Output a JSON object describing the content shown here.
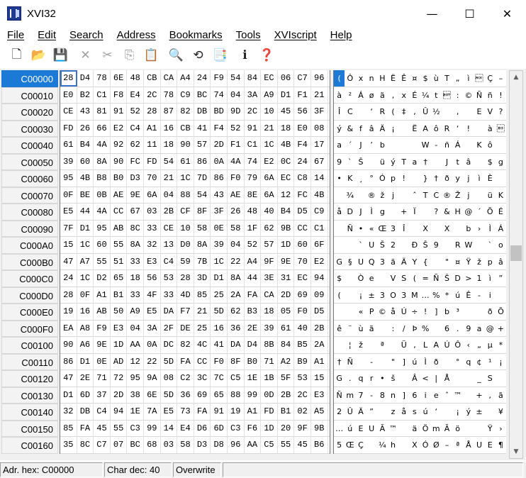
{
  "window": {
    "title": "XVI32",
    "minimize": "—",
    "maximize": "☐",
    "close": "✕"
  },
  "menu": [
    "File",
    "Edit",
    "Search",
    "Address",
    "Bookmarks",
    "Tools",
    "XVIscript",
    "Help"
  ],
  "toolbar": [
    {
      "name": "new-file-icon",
      "glyph": "🗋",
      "disabled": false
    },
    {
      "name": "open-folder-icon",
      "glyph": "📂",
      "disabled": false
    },
    {
      "name": "save-icon",
      "glyph": "💾",
      "disabled": false
    },
    {
      "name": "delete-icon",
      "glyph": "✕",
      "disabled": true
    },
    {
      "name": "cut-icon",
      "glyph": "✂",
      "disabled": true
    },
    {
      "name": "copy-icon",
      "glyph": "⎘",
      "disabled": true
    },
    {
      "name": "paste-icon",
      "glyph": "📋",
      "disabled": true
    },
    {
      "name": "find-icon",
      "glyph": "🔍",
      "disabled": false
    },
    {
      "name": "replace-icon",
      "glyph": "⟲",
      "disabled": false
    },
    {
      "name": "properties-icon",
      "glyph": "📑",
      "disabled": false
    },
    {
      "name": "script-icon",
      "glyph": "ℹ",
      "disabled": false
    },
    {
      "name": "context-help-icon",
      "glyph": "❓",
      "disabled": false
    }
  ],
  "rows": [
    {
      "addr": "C00000",
      "hex": [
        "28",
        "D4",
        "78",
        "6E",
        "48",
        "CB",
        "CA",
        "A4",
        "24",
        "F9",
        "54",
        "84",
        "EC",
        "06",
        "C7",
        "96"
      ],
      "chars": [
        "(",
        "Ô",
        "x",
        "n",
        "H",
        "Ë",
        "Ê",
        "¤",
        "$",
        "ù",
        "T",
        "„",
        "ì",
        "\u0006",
        "Ç",
        "–"
      ]
    },
    {
      "addr": "C00010",
      "hex": [
        "E0",
        "B2",
        "C1",
        "F8",
        "E4",
        "2C",
        "78",
        "C9",
        "BC",
        "74",
        "04",
        "3A",
        "A9",
        "D1",
        "F1",
        "21"
      ],
      "chars": [
        "à",
        "²",
        "Á",
        "ø",
        "ä",
        ",",
        "x",
        "É",
        "¼",
        "t",
        "\u0004",
        ":",
        "©",
        "Ñ",
        "ñ",
        "!"
      ]
    },
    {
      "addr": "C00020",
      "hex": [
        "CE",
        "43",
        "81",
        "91",
        "52",
        "28",
        "87",
        "82",
        "DB",
        "BD",
        "9D",
        "2C",
        "10",
        "45",
        "56",
        "3F"
      ],
      "chars": [
        "Î",
        "C",
        "",
        "‘",
        "R",
        "(",
        "‡",
        "‚",
        "Û",
        "½",
        "",
        ",",
        "",
        "E",
        "V",
        "?"
      ]
    },
    {
      "addr": "C00030",
      "hex": [
        "FD",
        "26",
        "66",
        "E2",
        "C4",
        "A1",
        "16",
        "CB",
        "41",
        "F4",
        "52",
        "91",
        "21",
        "18",
        "E0",
        "08"
      ],
      "chars": [
        "ý",
        "&",
        "f",
        "â",
        "Ä",
        "¡",
        "",
        "Ë",
        "A",
        "ô",
        "R",
        "‘",
        "!",
        "",
        "à",
        "\b"
      ]
    },
    {
      "addr": "C00040",
      "hex": [
        "61",
        "B4",
        "4A",
        "92",
        "62",
        "11",
        "18",
        "90",
        "57",
        "2D",
        "F1",
        "C1",
        "1C",
        "4B",
        "F4",
        "17"
      ],
      "chars": [
        "a",
        "´",
        "J",
        "’",
        "b",
        "",
        "",
        "",
        "W",
        "-",
        "ñ",
        "Á",
        "",
        "K",
        "ô",
        ""
      ]
    },
    {
      "addr": "C00050",
      "hex": [
        "39",
        "60",
        "8A",
        "90",
        "FC",
        "FD",
        "54",
        "61",
        "86",
        "0A",
        "4A",
        "74",
        "E2",
        "0C",
        "24",
        "67"
      ],
      "chars": [
        "9",
        "`",
        "Š",
        "",
        "ü",
        "ý",
        "T",
        "a",
        "†",
        "",
        "J",
        "t",
        "â",
        "",
        "$",
        "g"
      ]
    },
    {
      "addr": "C00060",
      "hex": [
        "95",
        "4B",
        "B8",
        "B0",
        "D3",
        "70",
        "21",
        "1C",
        "7D",
        "86",
        "F0",
        "79",
        "6A",
        "EC",
        "C8",
        "14"
      ],
      "chars": [
        "•",
        "K",
        "¸",
        "°",
        "Ó",
        "p",
        "!",
        "",
        "}",
        "†",
        "ð",
        "y",
        "j",
        "ì",
        "È",
        ""
      ]
    },
    {
      "addr": "C00070",
      "hex": [
        "0F",
        "BE",
        "0B",
        "AE",
        "9E",
        "6A",
        "04",
        "88",
        "54",
        "43",
        "AE",
        "8E",
        "6A",
        "12",
        "FC",
        "4B"
      ],
      "chars": [
        "",
        "¾",
        "",
        "®",
        "ž",
        "j",
        "",
        "ˆ",
        "T",
        "C",
        "®",
        "Ž",
        "j",
        "",
        "ü",
        "K"
      ]
    },
    {
      "addr": "C00080",
      "hex": [
        "E5",
        "44",
        "4A",
        "CC",
        "67",
        "03",
        "2B",
        "CF",
        "8F",
        "3F",
        "26",
        "48",
        "40",
        "B4",
        "D5",
        "C9"
      ],
      "chars": [
        "å",
        "D",
        "J",
        "Ì",
        "g",
        "",
        "+",
        "Ï",
        "",
        "?",
        "&",
        "H",
        "@",
        "´",
        "Õ",
        "É"
      ]
    },
    {
      "addr": "C00090",
      "hex": [
        "7F",
        "D1",
        "95",
        "AB",
        "8C",
        "33",
        "CE",
        "10",
        "58",
        "0E",
        "58",
        "1F",
        "62",
        "9B",
        "CC",
        "C1"
      ],
      "chars": [
        "",
        "Ñ",
        "•",
        "«",
        "Œ",
        "3",
        "Î",
        "",
        "X",
        "",
        "X",
        "",
        "b",
        "›",
        "Ì",
        "Á"
      ]
    },
    {
      "addr": "C000A0",
      "hex": [
        "15",
        "1C",
        "60",
        "55",
        "8A",
        "32",
        "13",
        "D0",
        "8A",
        "39",
        "04",
        "52",
        "57",
        "1D",
        "60",
        "6F"
      ],
      "chars": [
        "",
        "",
        "`",
        "U",
        "Š",
        "2",
        "",
        "Ð",
        "Š",
        "9",
        "",
        "R",
        "W",
        "",
        "`",
        "o"
      ]
    },
    {
      "addr": "C000B0",
      "hex": [
        "47",
        "A7",
        "55",
        "51",
        "33",
        "E3",
        "C4",
        "59",
        "7B",
        "1C",
        "22",
        "A4",
        "9F",
        "9E",
        "70",
        "E2"
      ],
      "chars": [
        "G",
        "§",
        "U",
        "Q",
        "3",
        "ã",
        "Ä",
        "Y",
        "{",
        "",
        "\"",
        "¤",
        "Ÿ",
        "ž",
        "p",
        "â"
      ]
    },
    {
      "addr": "C000C0",
      "hex": [
        "24",
        "1C",
        "D2",
        "65",
        "18",
        "56",
        "53",
        "28",
        "3D",
        "D1",
        "8A",
        "44",
        "3E",
        "31",
        "EC",
        "94"
      ],
      "chars": [
        "$",
        "",
        "Ò",
        "e",
        "",
        "V",
        "S",
        "(",
        "=",
        "Ñ",
        "Š",
        "D",
        ">",
        "1",
        "ì",
        "”"
      ]
    },
    {
      "addr": "C000D0",
      "hex": [
        "28",
        "0F",
        "A1",
        "B1",
        "33",
        "4F",
        "33",
        "4D",
        "85",
        "25",
        "2A",
        "FA",
        "CA",
        "2D",
        "69",
        "09"
      ],
      "chars": [
        "(",
        "",
        "¡",
        "±",
        "3",
        "O",
        "3",
        "M",
        "…",
        "%",
        "*",
        "ú",
        "Ê",
        "-",
        "i",
        ""
      ]
    },
    {
      "addr": "C000E0",
      "hex": [
        "19",
        "16",
        "AB",
        "50",
        "A9",
        "E5",
        "DA",
        "F7",
        "21",
        "5D",
        "62",
        "B3",
        "18",
        "05",
        "F0",
        "D5"
      ],
      "chars": [
        "",
        "",
        "«",
        "P",
        "©",
        "å",
        "Ú",
        "÷",
        "!",
        "]",
        "b",
        "³",
        "",
        "",
        "ð",
        "Õ"
      ]
    },
    {
      "addr": "C000F0",
      "hex": [
        "EA",
        "A8",
        "F9",
        "E3",
        "04",
        "3A",
        "2F",
        "DE",
        "25",
        "16",
        "36",
        "2E",
        "39",
        "61",
        "40",
        "2B"
      ],
      "chars": [
        "ê",
        "¨",
        "ù",
        "ã",
        "",
        ":",
        "/",
        "Þ",
        "%",
        "",
        "6",
        ".",
        "9",
        "a",
        "@",
        "+"
      ]
    },
    {
      "addr": "C00100",
      "hex": [
        "90",
        "A6",
        "9E",
        "1D",
        "AA",
        "0A",
        "DC",
        "82",
        "4C",
        "41",
        "DA",
        "D4",
        "8B",
        "84",
        "B5",
        "2A"
      ],
      "chars": [
        "",
        "¦",
        "ž",
        "",
        "ª",
        "",
        "Ü",
        "‚",
        "L",
        "A",
        "Ú",
        "Ô",
        "‹",
        "„",
        "µ",
        "*"
      ]
    },
    {
      "addr": "C00110",
      "hex": [
        "86",
        "D1",
        "0E",
        "AD",
        "12",
        "22",
        "5D",
        "FA",
        "CC",
        "F0",
        "8F",
        "B0",
        "71",
        "A2",
        "B9",
        "A1"
      ],
      "chars": [
        "†",
        "Ñ",
        "",
        "-",
        "",
        "\"",
        "]",
        "ú",
        "Ì",
        "ð",
        "",
        "°",
        "q",
        "¢",
        "¹",
        "¡"
      ]
    },
    {
      "addr": "C00120",
      "hex": [
        "47",
        "2E",
        "71",
        "72",
        "95",
        "9A",
        "08",
        "C2",
        "3C",
        "7C",
        "C5",
        "1E",
        "1B",
        "5F",
        "53",
        "15"
      ],
      "chars": [
        "G",
        ".",
        "q",
        "r",
        "•",
        "š",
        "",
        "Â",
        "<",
        "|",
        "Å",
        "",
        "",
        "_",
        "S",
        ""
      ]
    },
    {
      "addr": "C00130",
      "hex": [
        "D1",
        "6D",
        "37",
        "2D",
        "38",
        "6E",
        "5D",
        "36",
        "69",
        "65",
        "88",
        "99",
        "0D",
        "2B",
        "2C",
        "E3"
      ],
      "chars": [
        "Ñ",
        "m",
        "7",
        "-",
        "8",
        "n",
        "]",
        "6",
        "i",
        "e",
        "ˆ",
        "™",
        "",
        "+",
        ",",
        "ã"
      ]
    },
    {
      "addr": "C00140",
      "hex": [
        "32",
        "DB",
        "C4",
        "94",
        "1E",
        "7A",
        "E5",
        "73",
        "FA",
        "91",
        "19",
        "A1",
        "FD",
        "B1",
        "02",
        "A5"
      ],
      "chars": [
        "2",
        "Û",
        "Ä",
        "”",
        "",
        "z",
        "å",
        "s",
        "ú",
        "‘",
        "",
        "¡",
        "ý",
        "±",
        "",
        "¥"
      ]
    },
    {
      "addr": "C00150",
      "hex": [
        "85",
        "FA",
        "45",
        "55",
        "C3",
        "99",
        "14",
        "E4",
        "D6",
        "6D",
        "C3",
        "F6",
        "1D",
        "20",
        "9F",
        "9B"
      ],
      "chars": [
        "…",
        "ú",
        "E",
        "U",
        "Ã",
        "™",
        "",
        "ä",
        "Ö",
        "m",
        "Ã",
        "ö",
        "",
        " ",
        "Ÿ",
        "›"
      ]
    },
    {
      "addr": "C00160",
      "hex": [
        "35",
        "8C",
        "C7",
        "07",
        "BC",
        "68",
        "03",
        "58",
        "D3",
        "D8",
        "96",
        "AA",
        "C5",
        "55",
        "45",
        "B6"
      ],
      "chars": [
        "5",
        "Œ",
        "Ç",
        "",
        "¼",
        "h",
        "",
        "X",
        "Ó",
        "Ø",
        "–",
        "ª",
        "Å",
        "U",
        "E",
        "¶"
      ]
    }
  ],
  "status": {
    "address": "Adr. hex: C00000",
    "char": "Char dec: 40",
    "mode": "Overwrite"
  }
}
